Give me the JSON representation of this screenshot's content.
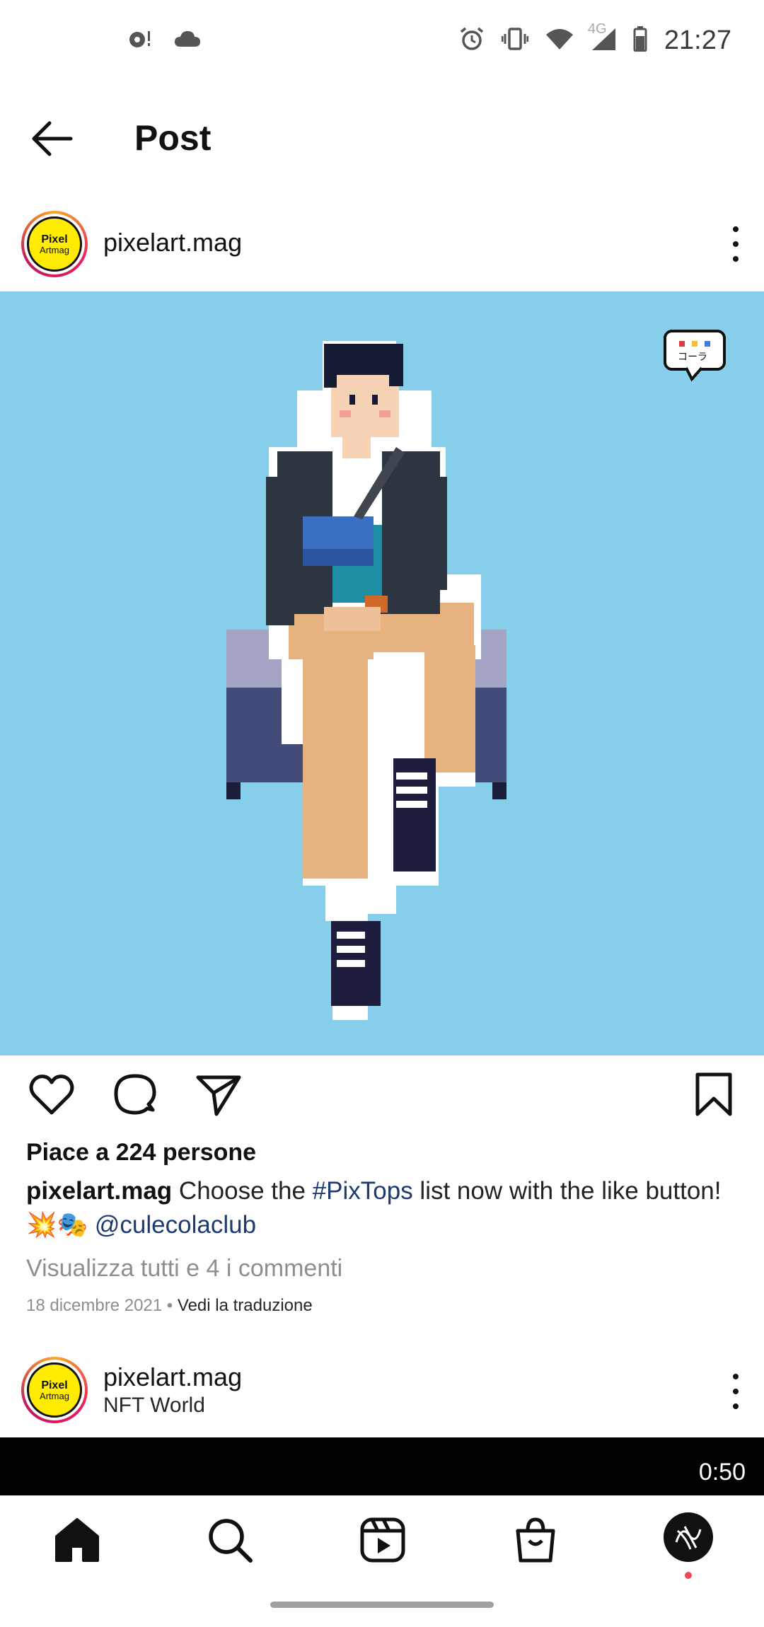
{
  "status_bar": {
    "time": "21:27",
    "network": "4G",
    "left_icons": [
      "notification-icon",
      "cloud-icon"
    ],
    "right_icons": [
      "alarm-icon",
      "vibrate-icon",
      "wifi-icon",
      "signal-icon",
      "battery-icon"
    ]
  },
  "header": {
    "title": "Post",
    "back_icon": "arrow-left-icon"
  },
  "post": {
    "username": "pixelart.mag",
    "avatar": {
      "line1": "Pixel",
      "line2": "Artmag"
    },
    "likes_text": "Piace a 224 persone",
    "caption": {
      "username": "pixelart.mag",
      "text_before_tag": " Choose the ",
      "hashtag": "#PixTops",
      "text_after_tag": " list now with the like button! 💥🎭 ",
      "mention": "@culecolaclub"
    },
    "view_comments": "Visualizza tutti e 4 i commenti",
    "date": "18 dicembre 2021",
    "separator": " • ",
    "translate": "Vedi la traduzione",
    "sticker_text": "コーラ"
  },
  "next_post": {
    "username": "pixelart.mag",
    "subtitle": "NFT World",
    "video_time": "0:50"
  },
  "bottom_nav": {
    "items": [
      "home-icon",
      "search-icon",
      "reels-icon",
      "shop-icon",
      "profile-avatar"
    ]
  },
  "colors": {
    "image_bg": "#87ceeb",
    "link": "#1e3a6e",
    "muted": "#8e8e8e",
    "notification_dot": "#ed4956"
  }
}
